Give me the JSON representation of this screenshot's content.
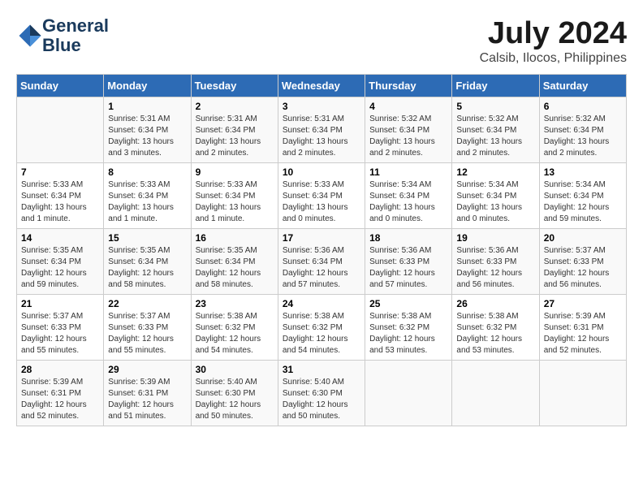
{
  "logo": {
    "line1": "General",
    "line2": "Blue"
  },
  "title": "July 2024",
  "location": "Calsib, Ilocos, Philippines",
  "days_of_week": [
    "Sunday",
    "Monday",
    "Tuesday",
    "Wednesday",
    "Thursday",
    "Friday",
    "Saturday"
  ],
  "weeks": [
    [
      {
        "day": "",
        "info": ""
      },
      {
        "day": "1",
        "info": "Sunrise: 5:31 AM\nSunset: 6:34 PM\nDaylight: 13 hours\nand 3 minutes."
      },
      {
        "day": "2",
        "info": "Sunrise: 5:31 AM\nSunset: 6:34 PM\nDaylight: 13 hours\nand 2 minutes."
      },
      {
        "day": "3",
        "info": "Sunrise: 5:31 AM\nSunset: 6:34 PM\nDaylight: 13 hours\nand 2 minutes."
      },
      {
        "day": "4",
        "info": "Sunrise: 5:32 AM\nSunset: 6:34 PM\nDaylight: 13 hours\nand 2 minutes."
      },
      {
        "day": "5",
        "info": "Sunrise: 5:32 AM\nSunset: 6:34 PM\nDaylight: 13 hours\nand 2 minutes."
      },
      {
        "day": "6",
        "info": "Sunrise: 5:32 AM\nSunset: 6:34 PM\nDaylight: 13 hours\nand 2 minutes."
      }
    ],
    [
      {
        "day": "7",
        "info": "Sunrise: 5:33 AM\nSunset: 6:34 PM\nDaylight: 13 hours\nand 1 minute."
      },
      {
        "day": "8",
        "info": "Sunrise: 5:33 AM\nSunset: 6:34 PM\nDaylight: 13 hours\nand 1 minute."
      },
      {
        "day": "9",
        "info": "Sunrise: 5:33 AM\nSunset: 6:34 PM\nDaylight: 13 hours\nand 1 minute."
      },
      {
        "day": "10",
        "info": "Sunrise: 5:33 AM\nSunset: 6:34 PM\nDaylight: 13 hours\nand 0 minutes."
      },
      {
        "day": "11",
        "info": "Sunrise: 5:34 AM\nSunset: 6:34 PM\nDaylight: 13 hours\nand 0 minutes."
      },
      {
        "day": "12",
        "info": "Sunrise: 5:34 AM\nSunset: 6:34 PM\nDaylight: 13 hours\nand 0 minutes."
      },
      {
        "day": "13",
        "info": "Sunrise: 5:34 AM\nSunset: 6:34 PM\nDaylight: 12 hours\nand 59 minutes."
      }
    ],
    [
      {
        "day": "14",
        "info": "Sunrise: 5:35 AM\nSunset: 6:34 PM\nDaylight: 12 hours\nand 59 minutes."
      },
      {
        "day": "15",
        "info": "Sunrise: 5:35 AM\nSunset: 6:34 PM\nDaylight: 12 hours\nand 58 minutes."
      },
      {
        "day": "16",
        "info": "Sunrise: 5:35 AM\nSunset: 6:34 PM\nDaylight: 12 hours\nand 58 minutes."
      },
      {
        "day": "17",
        "info": "Sunrise: 5:36 AM\nSunset: 6:34 PM\nDaylight: 12 hours\nand 57 minutes."
      },
      {
        "day": "18",
        "info": "Sunrise: 5:36 AM\nSunset: 6:33 PM\nDaylight: 12 hours\nand 57 minutes."
      },
      {
        "day": "19",
        "info": "Sunrise: 5:36 AM\nSunset: 6:33 PM\nDaylight: 12 hours\nand 56 minutes."
      },
      {
        "day": "20",
        "info": "Sunrise: 5:37 AM\nSunset: 6:33 PM\nDaylight: 12 hours\nand 56 minutes."
      }
    ],
    [
      {
        "day": "21",
        "info": "Sunrise: 5:37 AM\nSunset: 6:33 PM\nDaylight: 12 hours\nand 55 minutes."
      },
      {
        "day": "22",
        "info": "Sunrise: 5:37 AM\nSunset: 6:33 PM\nDaylight: 12 hours\nand 55 minutes."
      },
      {
        "day": "23",
        "info": "Sunrise: 5:38 AM\nSunset: 6:32 PM\nDaylight: 12 hours\nand 54 minutes."
      },
      {
        "day": "24",
        "info": "Sunrise: 5:38 AM\nSunset: 6:32 PM\nDaylight: 12 hours\nand 54 minutes."
      },
      {
        "day": "25",
        "info": "Sunrise: 5:38 AM\nSunset: 6:32 PM\nDaylight: 12 hours\nand 53 minutes."
      },
      {
        "day": "26",
        "info": "Sunrise: 5:38 AM\nSunset: 6:32 PM\nDaylight: 12 hours\nand 53 minutes."
      },
      {
        "day": "27",
        "info": "Sunrise: 5:39 AM\nSunset: 6:31 PM\nDaylight: 12 hours\nand 52 minutes."
      }
    ],
    [
      {
        "day": "28",
        "info": "Sunrise: 5:39 AM\nSunset: 6:31 PM\nDaylight: 12 hours\nand 52 minutes."
      },
      {
        "day": "29",
        "info": "Sunrise: 5:39 AM\nSunset: 6:31 PM\nDaylight: 12 hours\nand 51 minutes."
      },
      {
        "day": "30",
        "info": "Sunrise: 5:40 AM\nSunset: 6:30 PM\nDaylight: 12 hours\nand 50 minutes."
      },
      {
        "day": "31",
        "info": "Sunrise: 5:40 AM\nSunset: 6:30 PM\nDaylight: 12 hours\nand 50 minutes."
      },
      {
        "day": "",
        "info": ""
      },
      {
        "day": "",
        "info": ""
      },
      {
        "day": "",
        "info": ""
      }
    ]
  ]
}
